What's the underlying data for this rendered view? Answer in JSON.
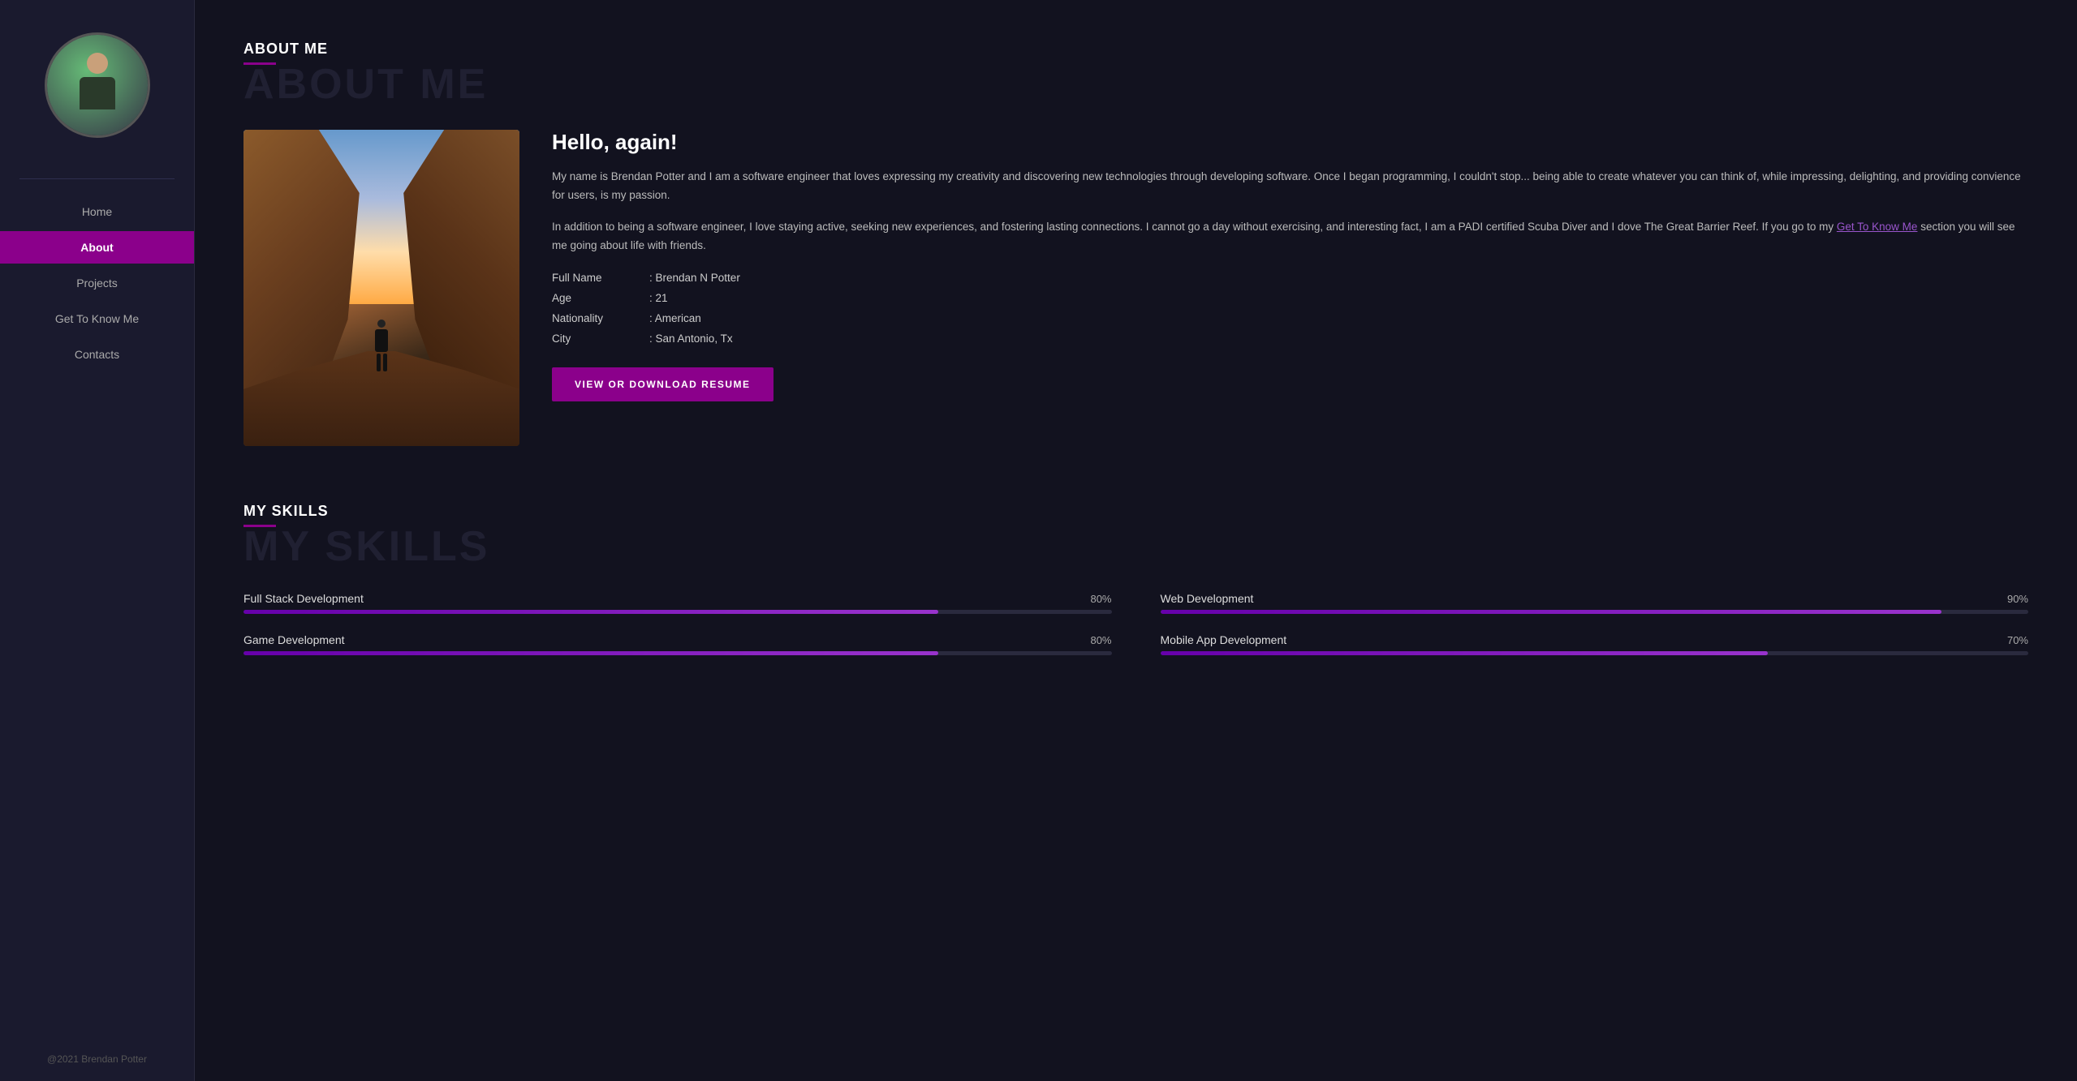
{
  "sidebar": {
    "avatar_alt": "Brendan Potter",
    "footer": "@2021 Brendan Potter",
    "nav_items": [
      {
        "label": "Home",
        "active": false,
        "id": "home"
      },
      {
        "label": "About",
        "active": true,
        "id": "about"
      },
      {
        "label": "Projects",
        "active": false,
        "id": "projects"
      },
      {
        "label": "Get To Know Me",
        "active": false,
        "id": "get-to-know"
      },
      {
        "label": "Contacts",
        "active": false,
        "id": "contacts"
      }
    ]
  },
  "about": {
    "section_title": "ABOUT ME",
    "section_bg_title": "ABOUT ME",
    "hello_title": "Hello, again!",
    "para1": "My name is Brendan Potter and I am a software engineer that loves expressing my creativity and discovering new technologies through developing software. Once I began programming, I couldn't stop... being able to create whatever you can think of, while impressing, delighting, and providing convience for users, is my passion.",
    "para2_before": "In addition to being a software engineer, I love staying active, seeking new experiences, and fostering lasting connections. I cannot go a day without exercising, and interesting fact, I am a PADI certified Scuba Diver and I dove The Great Barrier Reef. If you go to my ",
    "para2_link": "Get To Know Me",
    "para2_after": " section you will see me going about life with friends.",
    "info": {
      "full_name_label": "Full Name",
      "full_name_value": ": Brendan N Potter",
      "age_label": "Age",
      "age_value": ": 21",
      "nationality_label": "Nationality",
      "nationality_value": ": American",
      "city_label": "City",
      "city_value": ": San Antonio, Tx"
    },
    "resume_btn": "VIEW OR DOWNLOAD RESUME"
  },
  "skills": {
    "section_title": "MY SKILLS",
    "section_bg_title": "MY SKILLS",
    "items": [
      {
        "name": "Full Stack Development",
        "pct": 80
      },
      {
        "name": "Web Development",
        "pct": 90
      },
      {
        "name": "Game Development",
        "pct": 80
      },
      {
        "name": "Mobile App Development",
        "pct": 70
      }
    ]
  }
}
